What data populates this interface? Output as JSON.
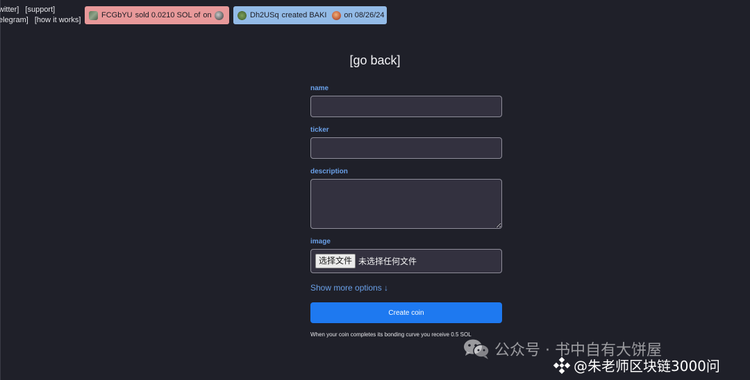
{
  "topnav": {
    "row1": [
      "witter]",
      "[support]"
    ],
    "row2": [
      "elegram]",
      "[how it works]"
    ]
  },
  "tickers": {
    "sell": {
      "user": "FCGbYU",
      "text": "sold 0.0210 SOL of",
      "suffix": "on",
      "color": "#e8999a"
    },
    "create": {
      "user": "Dh2USq",
      "text": "created BAKI",
      "suffix": "on 08/26/24",
      "color": "#93bbe7"
    }
  },
  "go_back": "[go back]",
  "form": {
    "name_label": "name",
    "name_value": "",
    "ticker_label": "ticker",
    "ticker_value": "",
    "description_label": "description",
    "description_value": "",
    "image_label": "image",
    "file_button": "选择文件",
    "file_status": "未选择任何文件",
    "more_options": "Show more options ↓",
    "create_button": "Create coin",
    "footnote": "When your coin completes its bonding curve you receive 0.5 SOL"
  },
  "watermark": {
    "line1": "公众号 · 书中自有大饼屋",
    "line2": "@朱老师区块链3000问"
  },
  "colors": {
    "background": "#1f2029",
    "accent": "#1e79f0",
    "label": "#6aa0e8",
    "input_bg": "#33313f"
  }
}
